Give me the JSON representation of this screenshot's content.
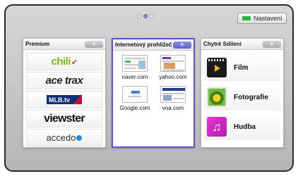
{
  "settings_label": "Nastavení",
  "pager": {
    "pages": 3,
    "current": 2
  },
  "panels": {
    "premium": {
      "title": "Premium",
      "add": "+",
      "items": [
        {
          "name": "chili",
          "label": "chili"
        },
        {
          "name": "acetrax",
          "label": "ace trax"
        },
        {
          "name": "mlbtv",
          "label": "MLB.tv"
        },
        {
          "name": "viewster",
          "label": "viewster"
        },
        {
          "name": "accedo",
          "label": "accedo"
        }
      ]
    },
    "browser": {
      "title": "Internetový prohlížeč",
      "add": "+",
      "sites": [
        {
          "label": "naver.com"
        },
        {
          "label": "yahoo.com"
        },
        {
          "label": "Google.com"
        },
        {
          "label": "voa.com"
        }
      ]
    },
    "smart": {
      "title": "Chytré Sdílení",
      "add": "+",
      "items": [
        {
          "label": "Film",
          "icon": "film-icon"
        },
        {
          "label": "Fotografie",
          "icon": "photo-icon"
        },
        {
          "label": "Hudba",
          "icon": "music-icon"
        }
      ]
    }
  },
  "colors": {
    "focus_border": "#5b56c6",
    "green_key": "#27b93a"
  }
}
